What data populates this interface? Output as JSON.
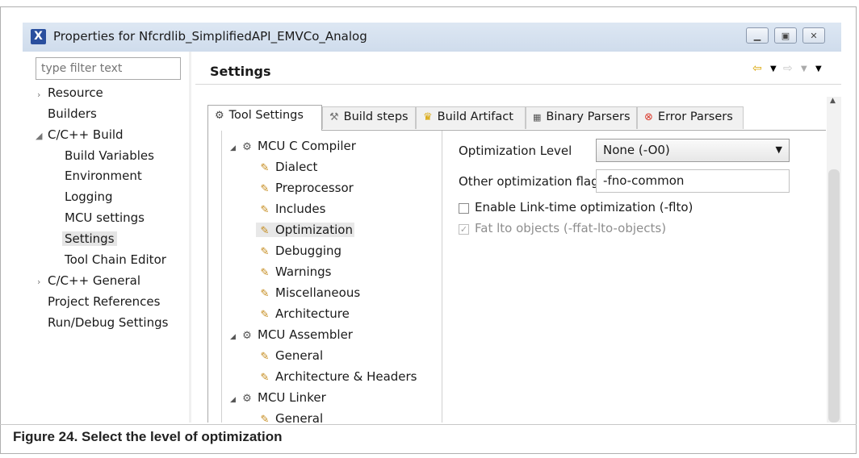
{
  "window": {
    "title": "Properties for Nfcrdlib_SimplifiedAPI_EMVCo_Analog",
    "app_icon": "X",
    "buttons": [
      "minimize-icon",
      "restore-icon",
      "close-icon"
    ]
  },
  "filter": {
    "placeholder": "type filter text"
  },
  "nav": {
    "items": [
      {
        "label": "Resource"
      },
      {
        "label": "Builders"
      },
      {
        "label": "C/C++ Build"
      },
      {
        "label": "Build Variables"
      },
      {
        "label": "Environment"
      },
      {
        "label": "Logging"
      },
      {
        "label": "MCU settings"
      },
      {
        "label": "Settings"
      },
      {
        "label": "Tool Chain Editor"
      },
      {
        "label": "C/C++ General"
      },
      {
        "label": "Project References"
      },
      {
        "label": "Run/Debug Settings"
      }
    ],
    "selected": "Settings"
  },
  "page": {
    "title": "Settings"
  },
  "tabs": [
    {
      "label": "Tool Settings",
      "icon": "gear-icon"
    },
    {
      "label": "Build steps",
      "icon": "build-icon"
    },
    {
      "label": "Build Artifact",
      "icon": "trophy-icon"
    },
    {
      "label": "Binary Parsers",
      "icon": "binary-icon"
    },
    {
      "label": "Error Parsers",
      "icon": "error-icon"
    }
  ],
  "tree": {
    "items": [
      {
        "label": "MCU C Compiler"
      },
      {
        "label": "Dialect"
      },
      {
        "label": "Preprocessor"
      },
      {
        "label": "Includes"
      },
      {
        "label": "Optimization"
      },
      {
        "label": "Debugging"
      },
      {
        "label": "Warnings"
      },
      {
        "label": "Miscellaneous"
      },
      {
        "label": "Architecture"
      },
      {
        "label": "MCU Assembler"
      },
      {
        "label": "General"
      },
      {
        "label": "Architecture & Headers"
      },
      {
        "label": "MCU Linker"
      },
      {
        "label": "General"
      }
    ],
    "selected": "Optimization"
  },
  "form": {
    "optimization_level_label": "Optimization Level",
    "optimization_level_value": "None (-O0)",
    "other_flags_label": "Other optimization flags",
    "other_flags_value": "-fno-common",
    "lto_label": "Enable Link-time optimization (-flto)",
    "lto_checked": false,
    "fat_lto_label": "Fat lto objects (-ffat-lto-objects)",
    "fat_lto_checked": true
  },
  "caption": "Figure 24.  Select the level of optimization"
}
